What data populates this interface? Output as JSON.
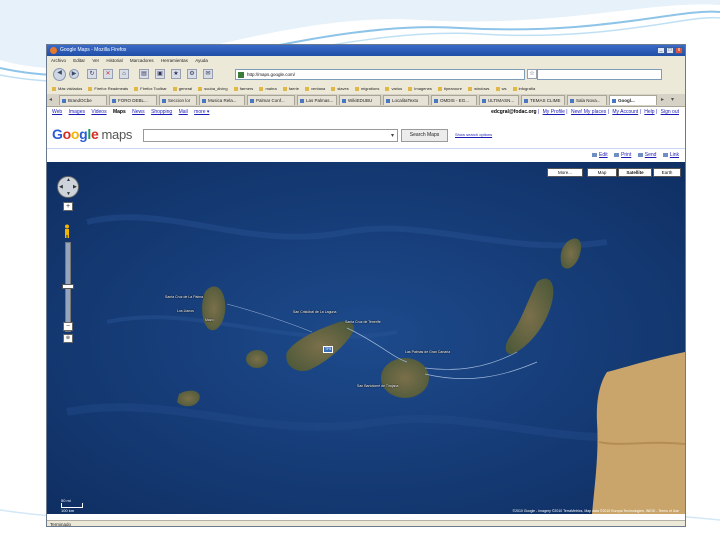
{
  "window": {
    "title": "Google Maps - Mozilla Firefox",
    "controls": [
      "_",
      "□",
      "x"
    ]
  },
  "menu": [
    "Archivo",
    "Editar",
    "Ver",
    "Historial",
    "Marcadores",
    "Herramientas",
    "Ayuda"
  ],
  "navigation": {
    "url": "http://maps.google.com/"
  },
  "bookmarks": [
    "Más visitados",
    "Firefox Readmeats",
    "Firefox Toolbar",
    "general",
    "scuba_diving",
    "farmers",
    "mahra",
    "faerie",
    "ventana",
    "slaves",
    "migrations",
    "varios",
    "Imagenes",
    "tipearoure",
    "windows",
    "ws",
    "infografía"
  ],
  "tabs": [
    {
      "label": "BrandOCbe"
    },
    {
      "label": "FORO DEBL..."
    },
    {
      "label": "Seccion lor"
    },
    {
      "label": "Musica Rela..."
    },
    {
      "label": "Palmar Conf..."
    },
    {
      "label": "Las Palmas..."
    },
    {
      "label": "WikiEDUBU"
    },
    {
      "label": "LocalitaTexto"
    },
    {
      "label": "OMDIS - EG..."
    },
    {
      "label": "ULTIMASN..."
    },
    {
      "label": "TEMAS CLIME"
    },
    {
      "label": "Sala Nova..."
    },
    {
      "label": "Googl..."
    }
  ],
  "google_bar": {
    "links": [
      "Web",
      "Images",
      "Videos",
      "Maps",
      "News",
      "Shopping",
      "Mail",
      "more ▾"
    ],
    "current": "Maps",
    "user_email": "edcgral@fodac.org",
    "user_links": [
      "My Profile",
      "New! My places",
      "My Account",
      "Help",
      "Sign out"
    ]
  },
  "search": {
    "logo_google": "Google",
    "logo_maps": "maps",
    "button_label": "Search Maps",
    "options_link": "Show search options"
  },
  "map_tools": [
    "Edit",
    "Print",
    "Send",
    "Link"
  ],
  "map_types": [
    {
      "label": "More...",
      "selected": false
    },
    {
      "label": "Map",
      "selected": false
    },
    {
      "label": "Satellite",
      "selected": true
    },
    {
      "label": "Earth",
      "selected": false
    }
  ],
  "map_labels": {
    "santa_cruz_la_palma": "Santa Cruz de La Palma",
    "los_llanos": "Los Llanos",
    "la_palma": "Mazo",
    "san_cristobal": "San Cristóbal de La Laguna",
    "santa_cruz_tenerife": "Santa Cruz de Tenerife",
    "las_palmas": "Las Palmas de Gran Canaria",
    "san_bartolome": "San Bartolomé de Tirajana"
  },
  "road_shield": "TF5",
  "scale": {
    "top": "50 mi",
    "bottom": "100 km"
  },
  "copyright": "©2010 Google - Imagery ©2010 TerraMetrics, Map data ©2010 Europa Technologies, INEGI - Terms of Use",
  "status": "Terminado",
  "colors": {
    "ocean": "#163c78",
    "land": "#6b6a4a",
    "desert": "#c9a56b",
    "google_blue": "#2a5bd7"
  }
}
